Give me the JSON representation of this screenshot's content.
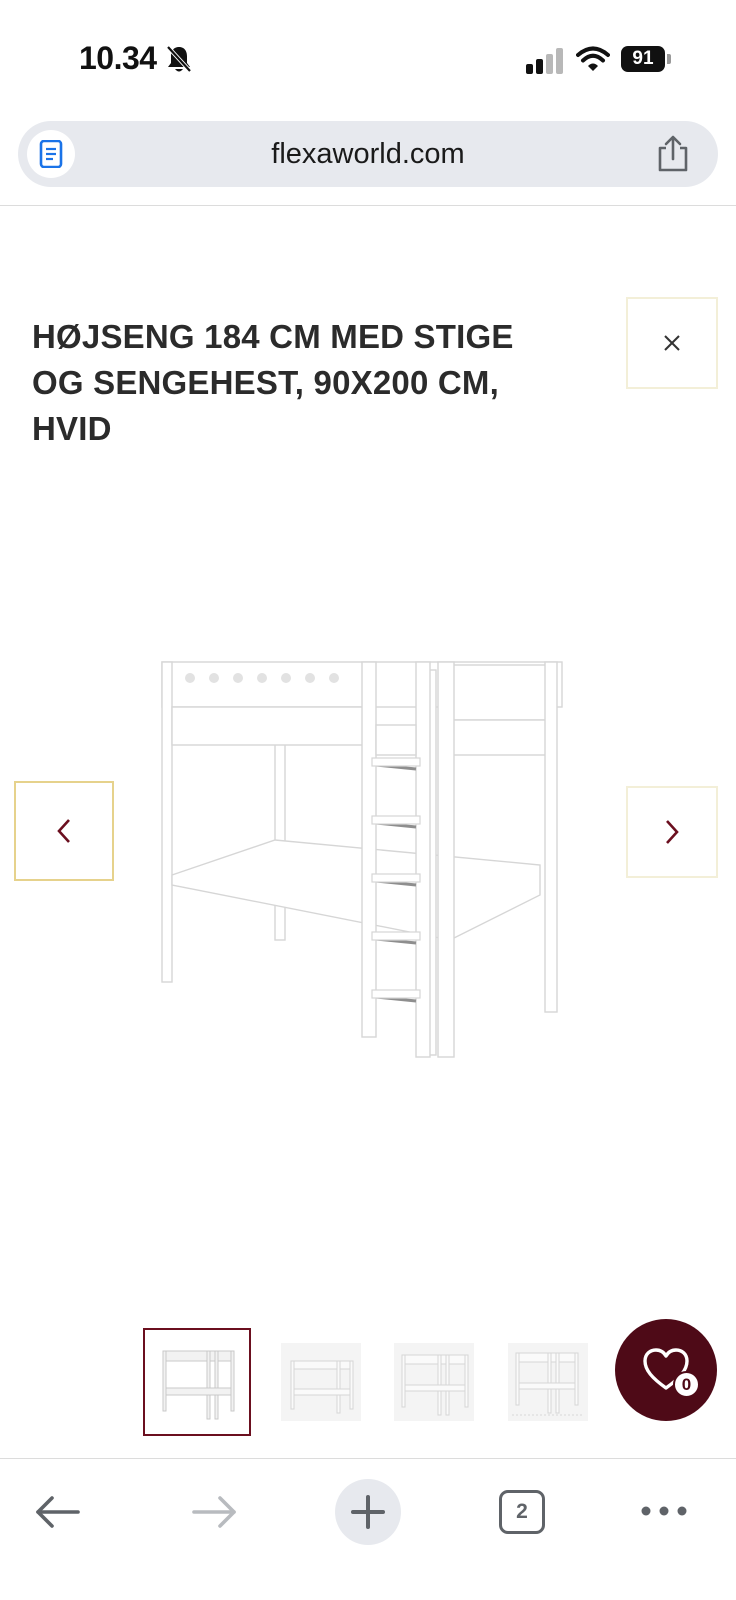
{
  "status_bar": {
    "time": "10.34",
    "battery": "91",
    "icons": [
      "bell-slash-icon",
      "signal-icon",
      "wifi-icon",
      "battery-icon"
    ]
  },
  "browser": {
    "url": "flexaworld.com",
    "reader_icon": "reader-mode-icon",
    "share_icon": "share-icon",
    "open_tabs": "2"
  },
  "product": {
    "title": "HØJSENG 184 CM MED STIGE OG SENGEHEST, 90X200 CM, HVID",
    "thumbnail_count": 4,
    "selected_thumbnail": 0
  },
  "wishlist": {
    "count": "0",
    "icon": "heart-icon"
  },
  "colors": {
    "accent": "#4e0a17",
    "thumb_selected": "#6b0f1f",
    "prev_border": "#e6d28c",
    "pale_border": "#f3efd8",
    "url_bar_bg": "#e7e9ee"
  }
}
